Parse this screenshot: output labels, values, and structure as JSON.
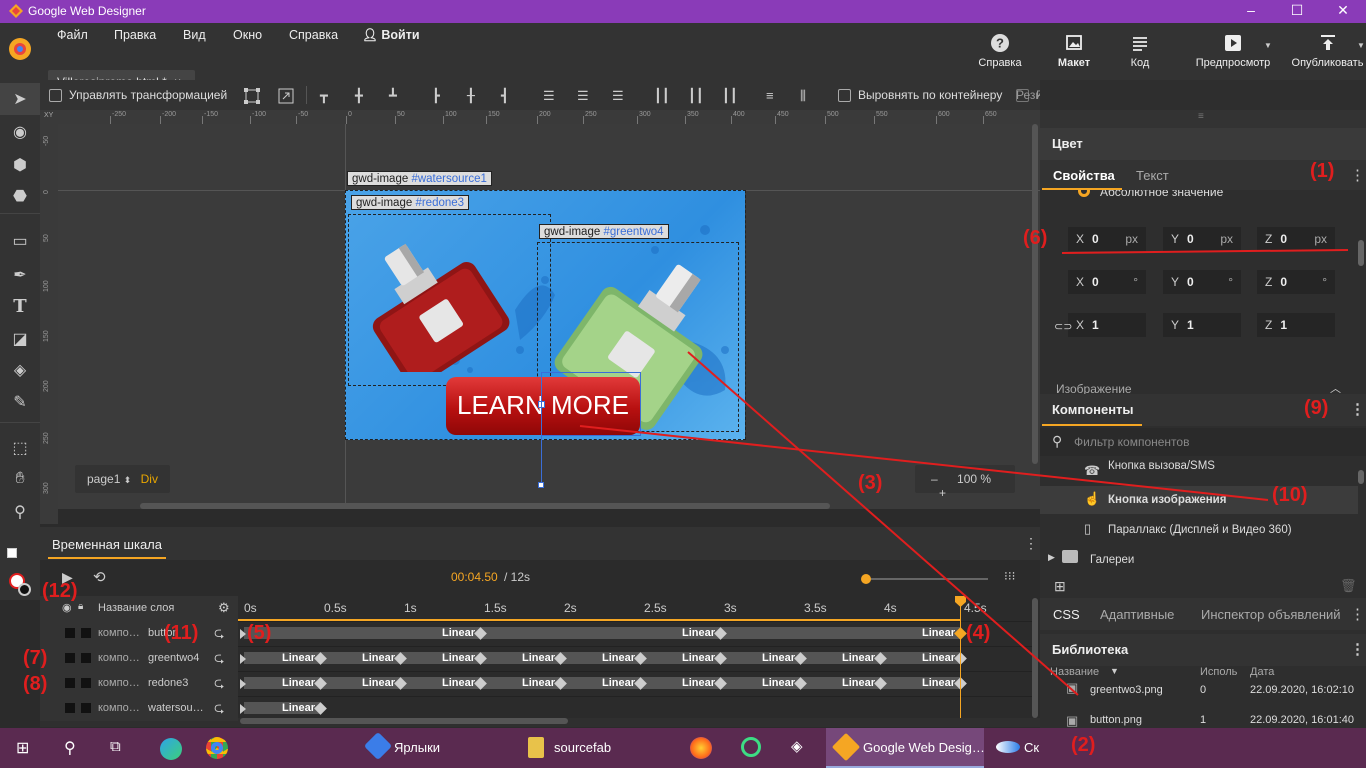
{
  "title_bar": {
    "title": "Google Web Designer",
    "minimize": "–",
    "maximize": "☐",
    "close": "✕"
  },
  "menu": {
    "file": "Файл",
    "edit": "Правка",
    "view": "Вид",
    "window": "Окно",
    "help": "Справка",
    "login": "Войти"
  },
  "document_tab": {
    "name": "Villoresipromo.html *",
    "close": "×"
  },
  "top_buttons": {
    "help": "Справка",
    "layout": "Макет",
    "code": "Код",
    "preview": "Предпросмотр",
    "publish": "Опубликовать"
  },
  "toolbar": {
    "manage_transform": "Управлять трансформацией",
    "align_container": "Выровнять по контейнеру",
    "rubber_layout": "Резиновый макет"
  },
  "ruler_h": {
    "labels": [
      "0",
      "-250",
      "-200",
      "-150",
      "-100",
      "-50",
      "0",
      "50",
      "100",
      "150",
      "200",
      "250",
      "300",
      "350",
      "400",
      "450",
      "500",
      "550",
      "600",
      "650"
    ],
    "xy_label": "XY"
  },
  "ruler_v": {
    "labels": [
      "-50",
      "0",
      "50",
      "100",
      "150",
      "200",
      "250",
      "300"
    ]
  },
  "stage": {
    "label_watersource": {
      "tag": "gwd-image",
      "id": "#watersource1"
    },
    "label_redone": {
      "tag": "gwd-image",
      "id": "#redone3"
    },
    "label_greentwo": {
      "tag": "gwd-image",
      "id": "#greentwo4"
    },
    "button_text": "LEARN MORE",
    "page_selector": "page1",
    "page_element": "Div",
    "zoom_minus": "–",
    "zoom_value": "100",
    "zoom_unit": "%",
    "zoom_plus": "+"
  },
  "timeline": {
    "title": "Временная шкала",
    "current_time": "00:04.50",
    "total_time": "/ 12s",
    "layer_column": "Название слоя",
    "ticks": [
      "0s",
      "0.5s",
      "1s",
      "1.5s",
      "2s",
      "2.5s",
      "3s",
      "3.5s",
      "4s",
      "4.5s"
    ],
    "layers": [
      {
        "prefix": "компо…",
        "name": "button"
      },
      {
        "prefix": "компо…",
        "name": "greentwo4"
      },
      {
        "prefix": "компо…",
        "name": "redone3"
      },
      {
        "prefix": "компо…",
        "name": "watersou…"
      }
    ],
    "easing": "Linear"
  },
  "right_panel": {
    "color_header": "Цвет",
    "tab_properties": "Свойства",
    "tab_text": "Текст",
    "absolute_value": "Абсолютное значение",
    "pos": {
      "x": "0",
      "y": "0",
      "z": "0",
      "unit": "px"
    },
    "rot": {
      "x": "0",
      "y": "0",
      "z": "0",
      "unit": "°"
    },
    "scale": {
      "x": "1",
      "y": "1",
      "z": "1"
    },
    "axis_x": "X",
    "axis_y": "Y",
    "axis_z": "Z",
    "image_section": "Изображение",
    "components_header": "Компоненты",
    "filter_placeholder": "Фильтр компонентов",
    "components": [
      "Кнопка вызова/SMS",
      "Кнопка изображения",
      "Параллакс (Дисплей и Видео 360)",
      "Галереи"
    ],
    "tabs_bottom": [
      "CSS",
      "Адаптивные",
      "Инспектор объявлений"
    ],
    "library_header": "Библиотека",
    "lib_columns": {
      "name": "Название",
      "used": "Исполь",
      "date": "Дата"
    },
    "lib_files": [
      {
        "name": "greentwo3.png",
        "used": "0",
        "date": "22.09.2020, 16:02:10"
      },
      {
        "name": "button.png",
        "used": "1",
        "date": "22.09.2020, 16:01:40"
      }
    ]
  },
  "annotations": {
    "a1": "(1)",
    "a2": "(2)",
    "a3": "(3)",
    "a4": "(4)",
    "a5": "(5)",
    "a6": "(6)",
    "a7": "(7)",
    "a8": "(8)",
    "a9": "(9)",
    "a10": "(10)",
    "a11": "(11)",
    "a12": "(12)"
  },
  "taskbar": {
    "items": [
      "Ярлыки",
      "sourcefab",
      "Google Web Desig…",
      "Скр"
    ]
  }
}
